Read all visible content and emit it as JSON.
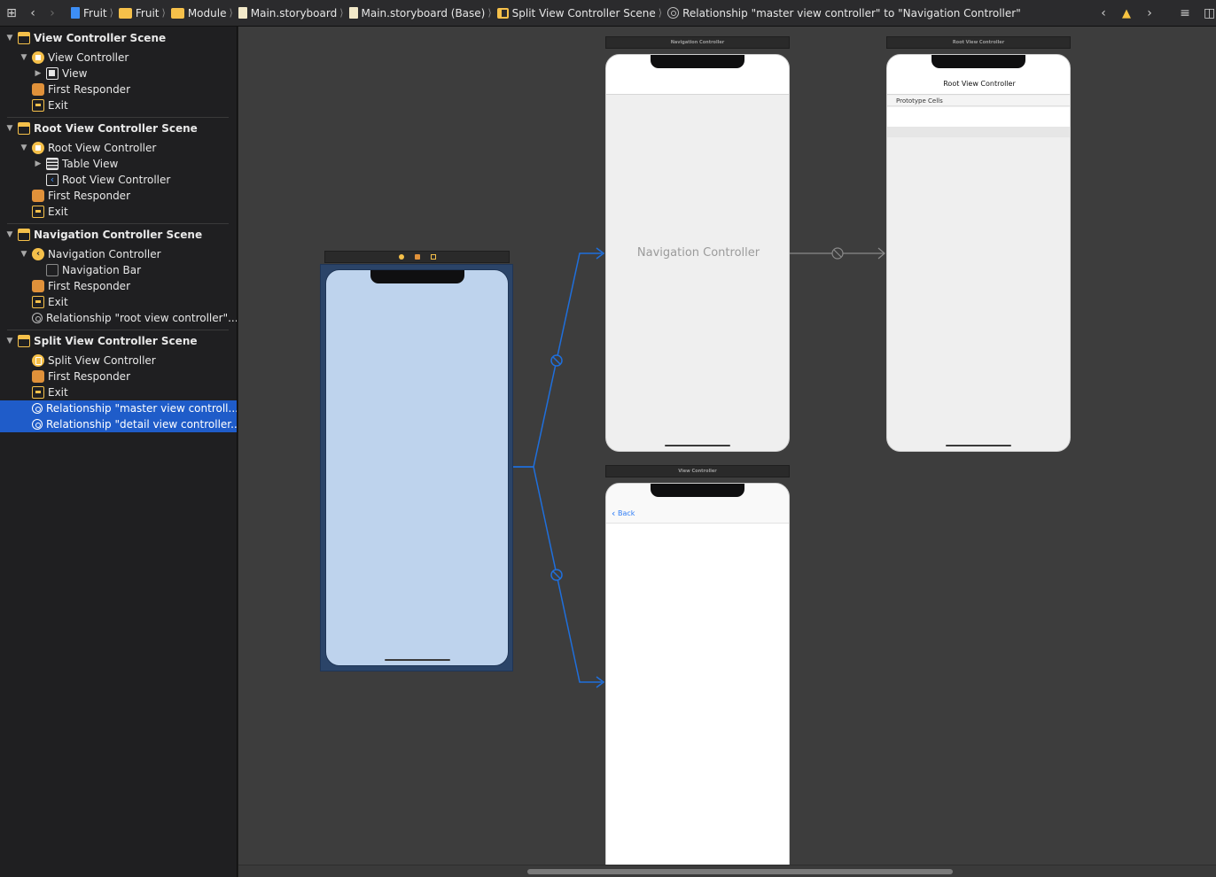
{
  "jumpbar": {
    "grid_icon": "grid-icon",
    "crumbs": [
      "Fruit",
      "Fruit",
      "Module",
      "Main.storyboard",
      "Main.storyboard (Base)",
      "Split View Controller Scene",
      "Relationship \"master view controller\" to \"Navigation Controller\""
    ]
  },
  "outline": {
    "rows": [
      "View Controller Scene",
      "View Controller",
      "View",
      "First Responder",
      "Exit",
      "Root View Controller Scene",
      "Root View Controller",
      "Table View",
      "Root View Controller",
      "First Responder",
      "Exit",
      "Navigation Controller Scene",
      "Navigation Controller",
      "Navigation Bar",
      "First Responder",
      "Exit",
      "Relationship \"root view controller\"...",
      "Split View Controller Scene",
      "Split View Controller",
      "First Responder",
      "Exit",
      "Relationship \"master view controll...",
      "Relationship \"detail view controller..."
    ]
  },
  "canvas": {
    "nav_scene_title": "Navigation Controller",
    "nav_body_label": "Navigation Controller",
    "root_scene_title": "Root View Controller",
    "root_nav_title": "Root View Controller",
    "prototype_cells": "Prototype Cells",
    "vc_scene_title": "View Controller",
    "back_label": "Back"
  },
  "colors": {
    "selection": "#1f5cc9",
    "segue": "#1f6fdc",
    "split_fill": "#bed3ed",
    "scene_icon": "#f5c04a"
  }
}
